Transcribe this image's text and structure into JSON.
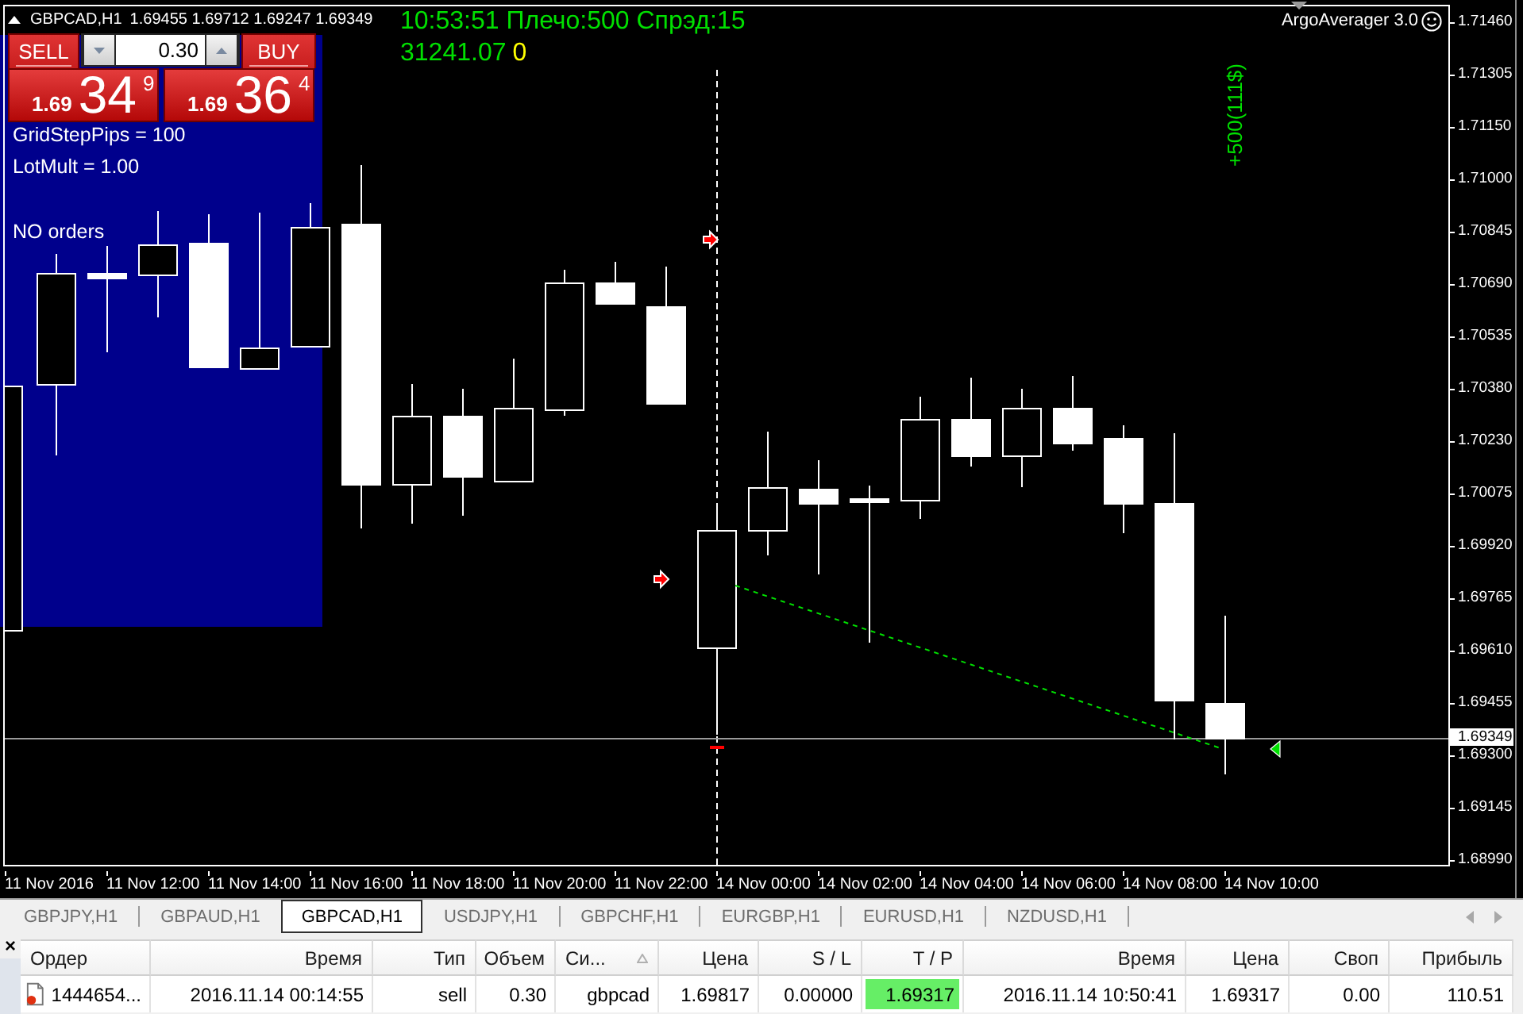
{
  "chart": {
    "header": {
      "symbol": "GBPCAD,H1",
      "quotes": "1.69455 1.69712 1.69247 1.69349"
    },
    "info_lines": [
      {
        "items": [
          {
            "text": "10:53:51 Плечо:500 Спрэд:15",
            "color": "#00e000"
          }
        ]
      },
      {
        "items": [
          {
            "text": "31241.07",
            "color": "#00e000"
          },
          {
            "text": "0",
            "color": "#ffff00"
          }
        ]
      }
    ],
    "expert": {
      "name": "ArgoAverager 3.0"
    },
    "vertical_label": "+500(111$)",
    "trade_panel": {
      "sell_label": "SELL",
      "buy_label": "BUY",
      "lot": "0.30",
      "sell_price": {
        "prefix": "1.69",
        "big": "34",
        "small": "9"
      },
      "buy_price": {
        "prefix": "1.69",
        "big": "36",
        "small": "4"
      }
    },
    "info_panel": {
      "settings": [
        "GridStepPips = 100",
        "LotMult = 1.00"
      ],
      "status": "NO orders"
    },
    "price_axis": {
      "ticks": [
        "1.71460",
        "1.71305",
        "1.71150",
        "1.71000",
        "1.70845",
        "1.70690",
        "1.70535",
        "1.70380",
        "1.70230",
        "1.70075",
        "1.69920",
        "1.69765",
        "1.69610",
        "1.69455",
        "1.69300",
        "1.69145",
        "1.68990"
      ],
      "current_price": "1.69349"
    },
    "time_axis": [
      "11 Nov 2016",
      "11 Nov 12:00",
      "11 Nov 14:00",
      "11 Nov 16:00",
      "11 Nov 18:00",
      "11 Nov 20:00",
      "11 Nov 22:00",
      "14 Nov 00:00",
      "14 Nov 02:00",
      "14 Nov 04:00",
      "14 Nov 06:00",
      "14 Nov 08:00",
      "14 Nov 10:00"
    ]
  },
  "tabs": [
    {
      "label": "GBPJPY,H1",
      "selected": false
    },
    {
      "label": "GBPAUD,H1",
      "selected": false
    },
    {
      "label": "GBPCAD,H1",
      "selected": true
    },
    {
      "label": "USDJPY,H1",
      "selected": false
    },
    {
      "label": "GBPCHF,H1",
      "selected": false
    },
    {
      "label": "EURGBP,H1",
      "selected": false
    },
    {
      "label": "EURUSD,H1",
      "selected": false
    },
    {
      "label": "NZDUSD,H1",
      "selected": false
    }
  ],
  "terminal": {
    "close_label": "×",
    "columns": [
      {
        "label": "Ордер",
        "sorted": false
      },
      {
        "label": "Время",
        "sorted": false
      },
      {
        "label": "Тип",
        "sorted": false
      },
      {
        "label": "Объем",
        "sorted": false
      },
      {
        "label": "Си...",
        "sorted": true
      },
      {
        "label": "Цена",
        "sorted": false
      },
      {
        "label": "S / L",
        "sorted": false
      },
      {
        "label": "T / P",
        "sorted": false
      },
      {
        "label": "Время",
        "sorted": false
      },
      {
        "label": "Цена",
        "sorted": false
      },
      {
        "label": "Своп",
        "sorted": false
      },
      {
        "label": "Прибыль",
        "sorted": false
      }
    ],
    "rows": [
      {
        "cells": [
          {
            "text": "1444654...",
            "highlighted": false
          },
          {
            "text": "2016.11.14 00:14:55",
            "highlighted": false
          },
          {
            "text": "sell",
            "highlighted": false
          },
          {
            "text": "0.30",
            "highlighted": false
          },
          {
            "text": "gbpcad",
            "highlighted": false
          },
          {
            "text": "1.69817",
            "highlighted": false
          },
          {
            "text": "0.00000",
            "highlighted": false
          },
          {
            "text": "1.69317",
            "highlighted": true
          },
          {
            "text": "2016.11.14 10:50:41",
            "highlighted": false
          },
          {
            "text": "1.69317",
            "highlighted": false
          },
          {
            "text": "0.00",
            "highlighted": false
          },
          {
            "text": "110.51",
            "highlighted": false
          }
        ]
      }
    ]
  }
}
